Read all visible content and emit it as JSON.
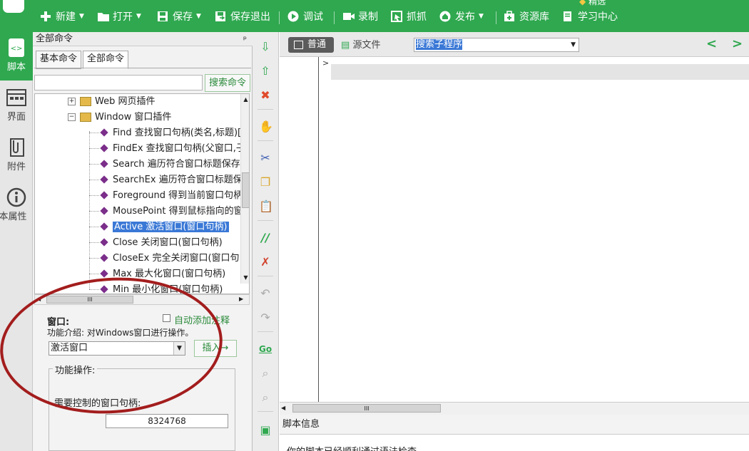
{
  "toolbar": {
    "new": "新建",
    "open": "打开",
    "save": "保存",
    "save_exit": "保存退出",
    "debug": "调试",
    "record": "录制",
    "capture": "抓抓",
    "publish": "发布",
    "resources": "资源库",
    "learning": "学习中心",
    "top_right_text": "精选",
    "colors": {
      "bg": "#2fa84f"
    }
  },
  "left_nav": {
    "items": [
      {
        "label": "脚本",
        "icon": "script-icon",
        "active": true
      },
      {
        "label": "界面",
        "icon": "interface-icon"
      },
      {
        "label": "附件",
        "icon": "attachment-icon"
      },
      {
        "label": "本属性",
        "icon": "info-icon"
      }
    ]
  },
  "cmd_panel": {
    "title": "全部命令",
    "pin": "ᵖ",
    "tabs": [
      "基本命令",
      "全部命令"
    ],
    "search_value": "",
    "search_button": "搜索命令",
    "tree": {
      "web_plugin": "Web 网页插件",
      "window_plugin": "Window 窗口插件",
      "items": [
        "Find 查找窗口句柄(类名,标题)[",
        "FindEx 查找窗口句柄(父窗口,子",
        "Search 遍历符合窗口标题保存",
        "SearchEx 遍历符合窗口标题保",
        "Foreground 得到当前窗口句柄",
        "MousePoint 得到鼠标指向的窗",
        "Active 激活窗口(窗口句柄)",
        "Close 关闭窗口(窗口句柄)",
        "CloseEx 完全关闭窗口(窗口句",
        "Max 最大化窗口(窗口句柄)",
        "Min 最小化窗口(窗口句柄)"
      ],
      "selected_index": 6
    },
    "hscroll_grip": "III",
    "detail": {
      "heading": "窗口:",
      "auto_comment_label": "自动添加注释",
      "intro": "功能介绍: 对Windows窗口进行操作。",
      "select_value": "激活窗口",
      "insert_button": "插入→",
      "fieldset_label": "功能操作:",
      "handle_label": "需要控制的窗口句柄:",
      "handle_value": "8324768"
    }
  },
  "editor": {
    "mode_normal": "普通",
    "mode_source": "源文件",
    "search_sub": "搜索子程序",
    "nav_prev": "<",
    "nav_next": ">",
    "hscroll_grip": "III",
    "info_title": "脚本信息",
    "info_text": "你的脚本已经顺利通过语法检查"
  }
}
